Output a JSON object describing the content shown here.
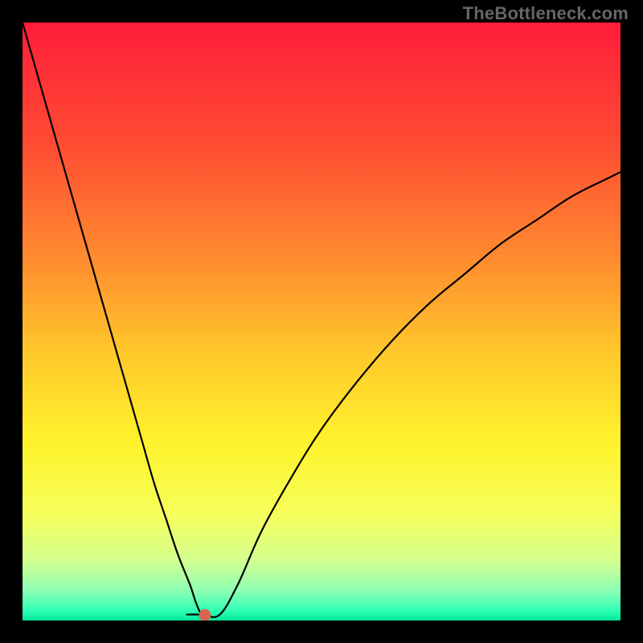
{
  "watermark": "TheBottleneck.com",
  "chart_data": {
    "type": "line",
    "title": "",
    "xlabel": "",
    "ylabel": "",
    "xlim": [
      0,
      100
    ],
    "ylim": [
      0,
      100
    ],
    "grid": false,
    "legend": false,
    "background_gradient_stops": [
      {
        "offset": 0.0,
        "color": "#ff1d3a"
      },
      {
        "offset": 0.2,
        "color": "#ff4b33"
      },
      {
        "offset": 0.4,
        "color": "#ff8d2f"
      },
      {
        "offset": 0.55,
        "color": "#ffc72b"
      },
      {
        "offset": 0.7,
        "color": "#fff22b"
      },
      {
        "offset": 0.82,
        "color": "#f7ff5a"
      },
      {
        "offset": 0.9,
        "color": "#d3ff8f"
      },
      {
        "offset": 0.95,
        "color": "#8dffb4"
      },
      {
        "offset": 0.985,
        "color": "#2bffb4"
      },
      {
        "offset": 1.0,
        "color": "#00e69c"
      }
    ],
    "series": [
      {
        "name": "bottleneck-curve",
        "color": "#000000",
        "width": 2.2,
        "x": [
          0,
          2,
          4,
          6,
          8,
          10,
          12,
          14,
          16,
          18,
          20,
          22,
          24,
          26,
          28,
          29,
          29.8,
          30.5,
          33,
          36,
          40,
          45,
          50,
          56,
          62,
          68,
          74,
          80,
          86,
          92,
          98,
          100
        ],
        "y": [
          100,
          93,
          86,
          79,
          72,
          65,
          58,
          51,
          44,
          37,
          30,
          23,
          17,
          11,
          6,
          3,
          1.2,
          0.9,
          1.0,
          6,
          15,
          24,
          32,
          40,
          47,
          53,
          58,
          63,
          67,
          71,
          74,
          75
        ]
      }
    ],
    "marker": {
      "name": "min-point-marker",
      "color": "#d8644f",
      "x": 30.5,
      "y": 0.9,
      "r": 1.0
    },
    "plateau": {
      "x0": 27.5,
      "x1": 30.5,
      "y": 1.0
    }
  }
}
